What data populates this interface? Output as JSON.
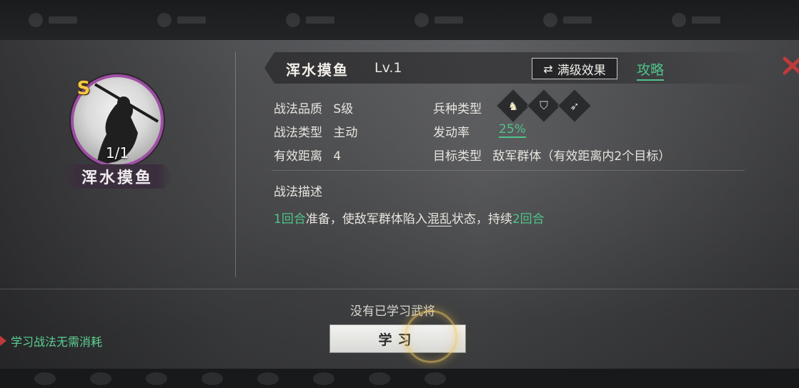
{
  "skill": {
    "grade_badge": "S",
    "count": "1/1",
    "name": "浑水摸鱼",
    "level": "Lv.1",
    "max_effect_label": "满级效果",
    "guide_label": "攻略"
  },
  "attributes": {
    "quality_label": "战法品质",
    "quality_value": "S级",
    "type_label": "战法类型",
    "type_value": "主动",
    "range_label": "有效距离",
    "range_value": "4",
    "troop_label": "兵种类型",
    "rate_label": "发动率",
    "rate_value": "25%",
    "target_label": "目标类型",
    "target_value": "敌军群体（有效距离内2个目标）"
  },
  "troop_icons": [
    "cavalry-icon",
    "shield-icon",
    "bow-icon"
  ],
  "description": {
    "heading": "战法描述",
    "seg1": "1回合",
    "seg2": "准备，使敌军群体陷入",
    "seg3": "混乱",
    "seg4": "状态，持续",
    "seg5": "2回合"
  },
  "footer": {
    "no_general_text": "没有已学习武将",
    "learn_button": "学习",
    "free_tip": "学习战法无需消耗"
  },
  "colors": {
    "accent_green": "#4fc489",
    "grade_gold": "#f4c644",
    "portrait_border": "#9d4fa3",
    "close_red": "#c03a3a"
  }
}
